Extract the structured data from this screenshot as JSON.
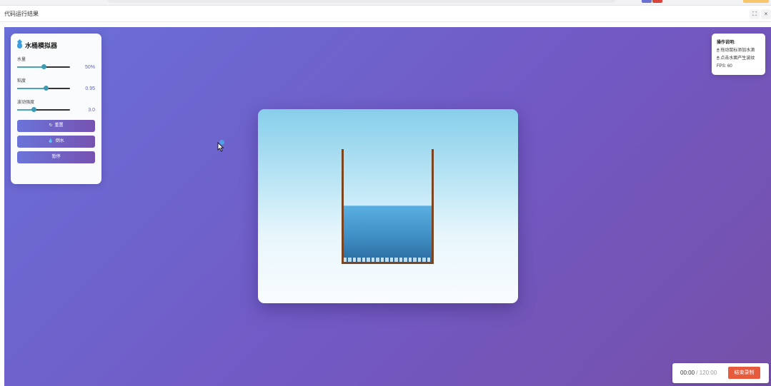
{
  "window": {
    "title": "代码运行结果",
    "fullscreen_icon": "expand-icon",
    "close_icon": "close-icon"
  },
  "panel": {
    "title": "水桶模拟器",
    "title_icon": "water-drop-icon",
    "controls": [
      {
        "label": "水量",
        "value_text": "50%",
        "fraction": 0.5
      },
      {
        "label": "粘度",
        "value_text": "0.95",
        "fraction": 0.55
      },
      {
        "label": "波动强度",
        "value_text": "3.0",
        "fraction": 0.32
      }
    ],
    "buttons": [
      {
        "label": "重置",
        "icon": "refresh-icon"
      },
      {
        "label": "倒水",
        "icon": "drop-icon"
      },
      {
        "label": "暂停",
        "icon": ""
      }
    ]
  },
  "help": {
    "title": "操作说明:",
    "lines": [
      "拖动鼠标添加水滴",
      "点击水面产生波纹"
    ],
    "fps": "FPS: 60"
  },
  "simulation": {
    "water_level": 0.5
  },
  "recorder": {
    "current_time": "00:00",
    "total_time": " / 120:00",
    "stop_label": "结束录制"
  },
  "colors": {
    "stage_gradient_start": "#6a70d8",
    "stage_gradient_end": "#7650a8",
    "water": "#3f8fc4",
    "bucket": "#7a4520",
    "accent": "#5a63c9",
    "stop_button": "#e85a3c"
  }
}
